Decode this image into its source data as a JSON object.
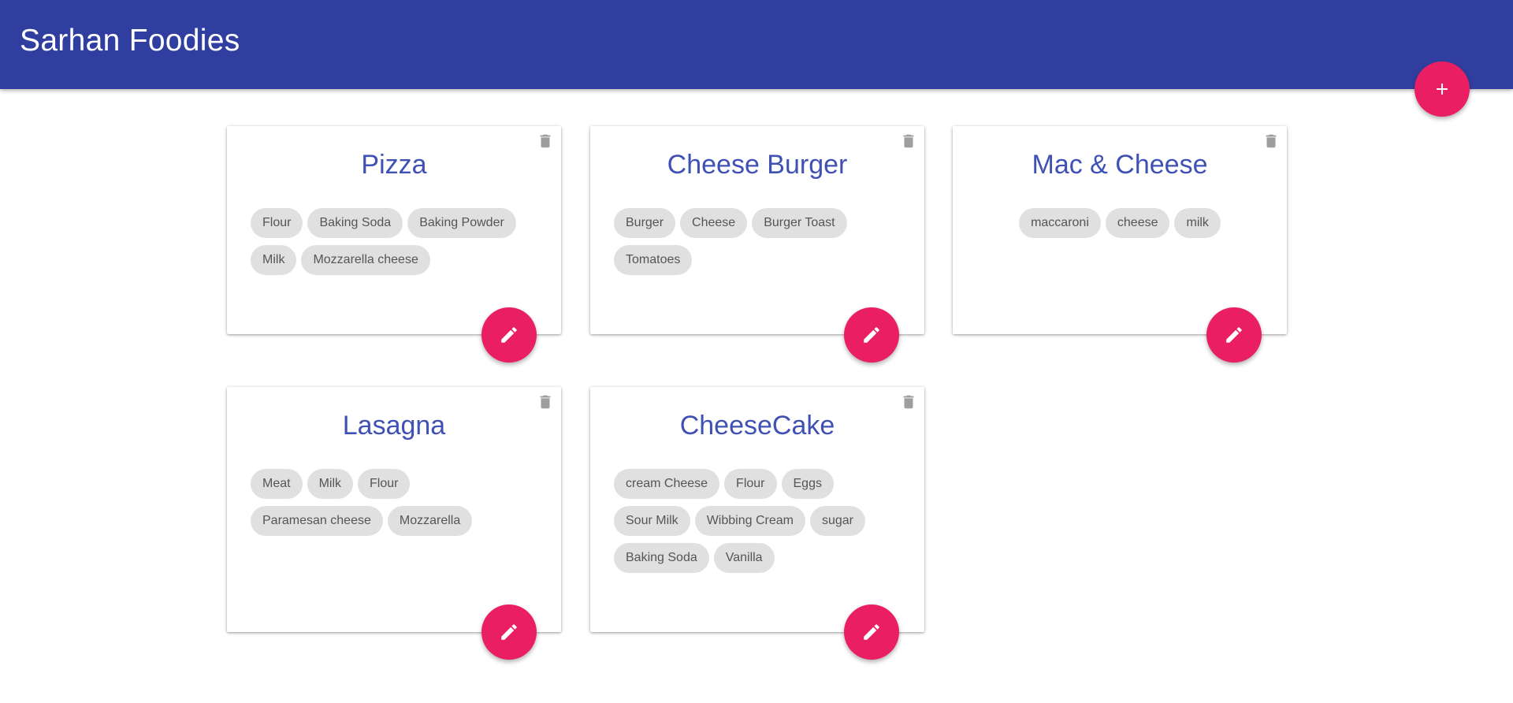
{
  "app": {
    "title": "Sarhan Foodies"
  },
  "colors": {
    "primary": "#303f9f",
    "accent": "#e91e63",
    "title_text": "#3f51b5",
    "chip_bg": "#e0e0e0"
  },
  "icons": {
    "add": "plus-icon",
    "edit": "pencil-icon",
    "delete": "trash-icon"
  },
  "recipes": [
    {
      "name": "Pizza",
      "ingredients": [
        "Flour",
        "Baking Soda",
        "Baking Powder",
        "Milk",
        "Mozzarella cheese"
      ]
    },
    {
      "name": "Cheese Burger",
      "ingredients": [
        "Burger",
        "Cheese",
        "Burger Toast",
        "Tomatoes"
      ]
    },
    {
      "name": "Mac & Cheese",
      "ingredients": [
        "maccaroni",
        "cheese",
        "milk"
      ]
    },
    {
      "name": "Lasagna",
      "ingredients": [
        "Meat",
        "Milk",
        "Flour",
        "Paramesan cheese",
        "Mozzarella"
      ]
    },
    {
      "name": "CheeseCake",
      "ingredients": [
        "cream Cheese",
        "Flour",
        "Eggs",
        "Sour Milk",
        "Wibbing Cream",
        "sugar",
        "Baking Soda",
        "Vanilla"
      ]
    }
  ]
}
